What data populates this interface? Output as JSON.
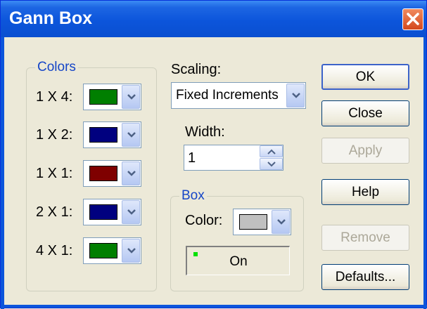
{
  "window": {
    "title": "Gann Box"
  },
  "colors_group": {
    "legend": "Colors",
    "rows": [
      {
        "label": "1 X 4:",
        "color": "#007f00"
      },
      {
        "label": "1 X 2:",
        "color": "#00007f"
      },
      {
        "label": "1 X 1:",
        "color": "#7f0000"
      },
      {
        "label": "2 X 1:",
        "color": "#00007f"
      },
      {
        "label": "4 X 1:",
        "color": "#007f00"
      }
    ]
  },
  "scaling": {
    "label": "Scaling:",
    "selected": "Fixed Increments"
  },
  "width": {
    "label": "Width:",
    "value": "1"
  },
  "box_group": {
    "legend": "Box",
    "color_label": "Color:",
    "color": "#c0c0c0",
    "status": "On"
  },
  "buttons": {
    "ok": "OK",
    "close": "Close",
    "apply": "Apply",
    "help": "Help",
    "remove": "Remove",
    "defaults": "Defaults..."
  }
}
